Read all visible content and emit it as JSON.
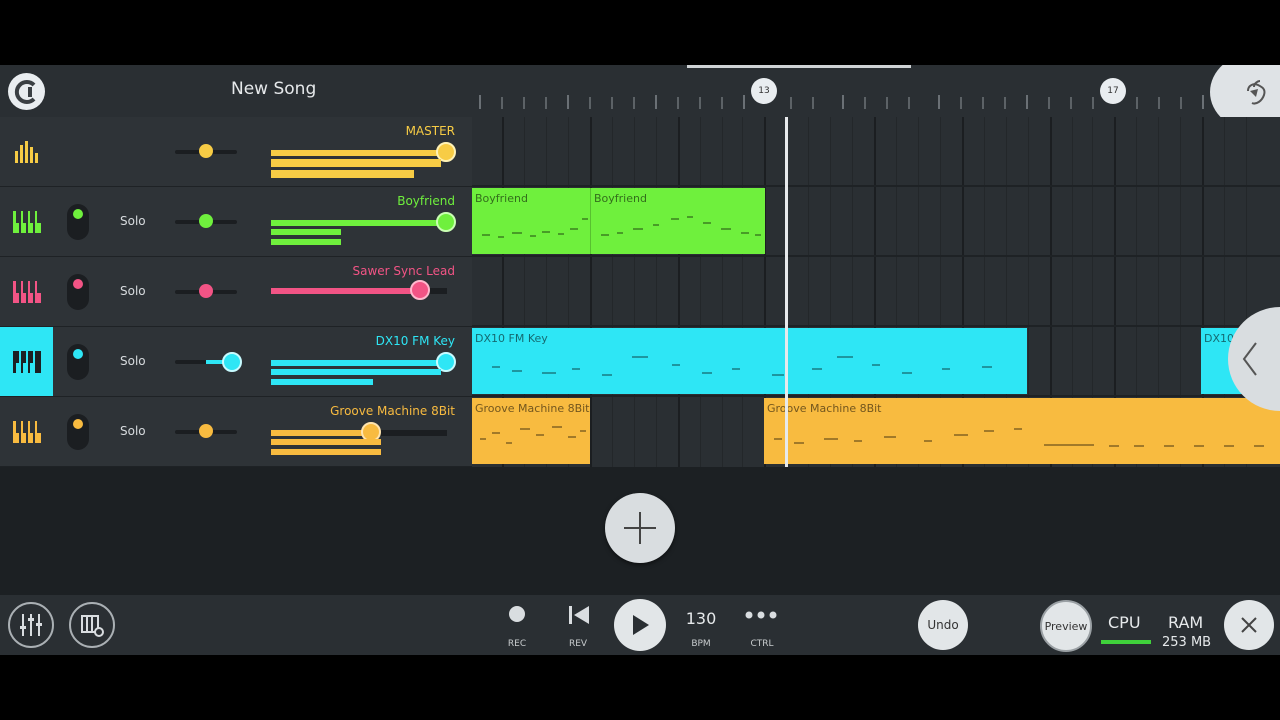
{
  "header": {
    "song_title": "New Song",
    "bar_markers": [
      "13",
      "17"
    ]
  },
  "tracks": [
    {
      "name": "MASTER",
      "color": "#f7cc45",
      "solo": "",
      "has_toggle": false
    },
    {
      "name": "Boyfriend",
      "color": "#6ff03d",
      "solo": "Solo",
      "has_toggle": true
    },
    {
      "name": "Sawer Sync Lead",
      "color": "#f25485",
      "solo": "Solo",
      "has_toggle": true
    },
    {
      "name": "DX10 FM Key",
      "color": "#2ee6f5",
      "solo": "Solo",
      "has_toggle": true
    },
    {
      "name": "Groove Machine 8Bit",
      "color": "#f8bb40",
      "solo": "Solo",
      "has_toggle": true
    }
  ],
  "clips": {
    "boyfriend_1": "Boyfriend",
    "boyfriend_2": "Boyfriend",
    "dx10_1": "DX10 FM Key",
    "dx10_2": "DX10",
    "groove_1": "Groove Machine 8Bit",
    "groove_2": "Groove Machine 8Bit"
  },
  "transport": {
    "rec_label": "REC",
    "rev_label": "REV",
    "bpm_value": "130",
    "bpm_label": "BPM",
    "ctrl_label": "CTRL",
    "undo_label": "Undo",
    "preview_label": "Preview",
    "cpu_label": "CPU",
    "ram_label": "RAM",
    "ram_value": "253 MB"
  },
  "colors": {
    "master": "#f7cc45",
    "boyfriend": "#6ff03d",
    "sawer": "#f25485",
    "dx10": "#2ee6f5",
    "groove": "#f8bb40",
    "cpu_meter": "#3fd13b"
  },
  "icons": [
    "app-logo-icon",
    "mixer-bars-icon",
    "piano-icon",
    "add-icon",
    "record-icon",
    "rewind-icon",
    "play-icon",
    "ctrl-dots-icon",
    "close-icon",
    "collapse-arrow-icon",
    "fruit-logo-icon",
    "mixer-sliders-icon",
    "piano-settings-icon"
  ]
}
